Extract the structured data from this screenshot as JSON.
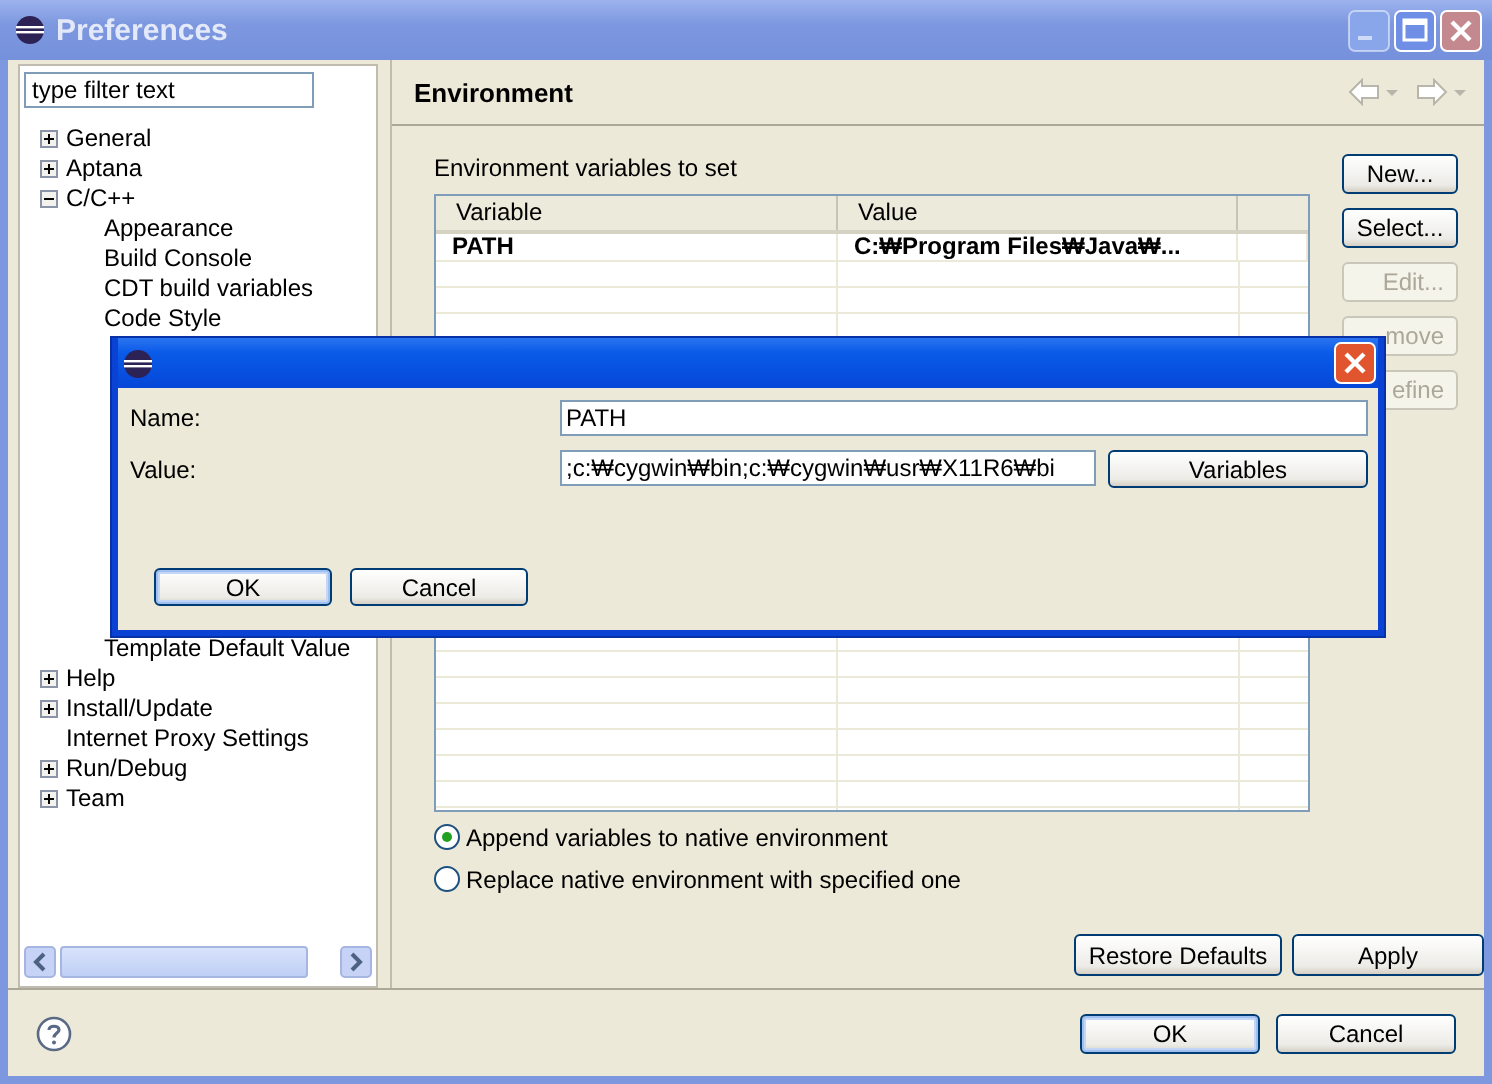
{
  "window": {
    "title": "Preferences"
  },
  "filter": {
    "value": "type filter text"
  },
  "tree": [
    {
      "label": "General",
      "kind": "node",
      "expanded": false
    },
    {
      "label": "Aptana",
      "kind": "node",
      "expanded": false
    },
    {
      "label": "C/C++",
      "kind": "node",
      "expanded": true,
      "children": [
        {
          "label": "Appearance"
        },
        {
          "label": "Build Console"
        },
        {
          "label": "CDT build variables"
        },
        {
          "label": "Code Style"
        },
        {
          "label": "Template Default Value",
          "kind": "hidden-gap"
        }
      ]
    },
    {
      "label": "Help",
      "kind": "node",
      "expanded": false
    },
    {
      "label": "Install/Update",
      "kind": "node",
      "expanded": false
    },
    {
      "label": "Internet Proxy Settings",
      "kind": "leaf"
    },
    {
      "label": "Run/Debug",
      "kind": "node",
      "expanded": false
    },
    {
      "label": "Team",
      "kind": "node",
      "expanded": false
    }
  ],
  "page": {
    "title": "Environment",
    "table_label": "Environment variables to set",
    "columns": [
      "Variable",
      "Value"
    ],
    "rows": [
      {
        "variable": "PATH",
        "value": "C:₩Program Files₩Java₩..."
      }
    ],
    "side_buttons": [
      {
        "label": "New...",
        "disabled": false
      },
      {
        "label": "Select...",
        "disabled": false
      },
      {
        "label": "Edit...",
        "disabled": true
      },
      {
        "label": "move",
        "disabled": true
      },
      {
        "label": "efine",
        "disabled": true
      }
    ],
    "options": [
      {
        "label": "Append variables to native environment",
        "selected": true
      },
      {
        "label": "Replace native environment with specified one",
        "selected": false
      }
    ],
    "buttons": [
      "Restore Defaults",
      "Apply"
    ]
  },
  "footer_buttons": [
    {
      "label": "OK",
      "default": true
    },
    {
      "label": "Cancel",
      "default": false
    }
  ],
  "dialog": {
    "fields": [
      {
        "label": "Name:",
        "value": "PATH"
      },
      {
        "label": "Value:",
        "value": ";c:₩cygwin₩bin;c:₩cygwin₩usr₩X11R6₩bi"
      }
    ],
    "variables_button": "Variables",
    "buttons": [
      {
        "label": "OK",
        "default": true
      },
      {
        "label": "Cancel",
        "default": false
      }
    ]
  }
}
